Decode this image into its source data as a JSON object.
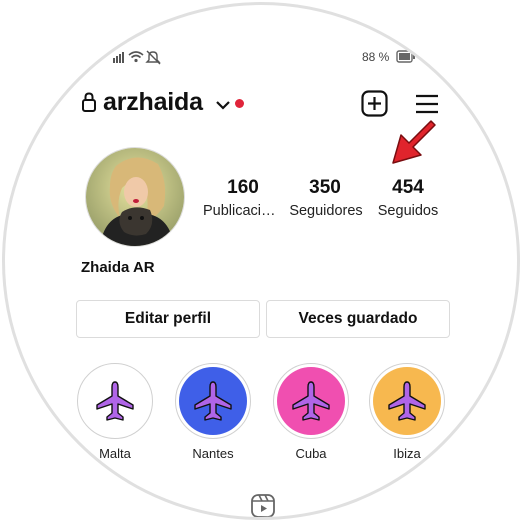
{
  "status_bar": {
    "battery": "88 %"
  },
  "header": {
    "username": "arzhaida"
  },
  "stats": [
    {
      "value": "160",
      "label": "Publicaciones"
    },
    {
      "value": "350",
      "label": "Seguidores"
    },
    {
      "value": "454",
      "label": "Seguidos"
    }
  ],
  "profile": {
    "display_name": "Zhaida AR"
  },
  "buttons": {
    "edit_profile": "Editar perfil",
    "saved": "Veces guardado"
  },
  "highlights": [
    {
      "label": "Malta",
      "bg": "#ffffff"
    },
    {
      "label": "Nantes",
      "bg": "#3f5fe8"
    },
    {
      "label": "Cuba",
      "bg": "#f04fb0"
    },
    {
      "label": "Ibiza",
      "bg": "#f7b84f"
    }
  ],
  "colors": {
    "accent_red": "#e0242c",
    "plane": "#b065e8",
    "notification_dot": "#e0243a"
  },
  "icons": [
    "lock-icon",
    "chevron-down-icon",
    "add-post-icon",
    "menu-icon",
    "red-arrow-icon",
    "airplane-icon",
    "reels-icon"
  ]
}
